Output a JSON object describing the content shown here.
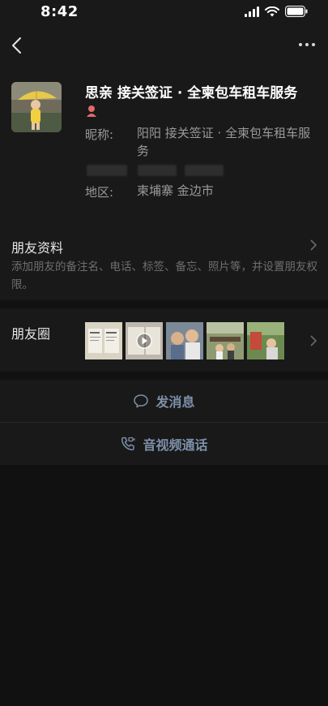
{
  "status_bar": {
    "time": "8:42"
  },
  "profile": {
    "name": "思亲 接关签证 · 全柬包车租车服务",
    "nickname_label": "昵称:",
    "nickname_value": "阳阳 接关签证 · 全柬包车租车服务",
    "region_label": "地区:",
    "region_value": "柬埔寨 金边市"
  },
  "friend_info": {
    "title": "朋友资料",
    "description": "添加朋友的备注名、电话、标签、备忘、照片等，并设置朋友权限。"
  },
  "moments": {
    "title": "朋友圈"
  },
  "actions": {
    "send_message": "发消息",
    "av_call": "音视频通话"
  },
  "colors": {
    "accent_link": "#7d90a9",
    "background": "#111111",
    "panel": "#191919",
    "gender_female": "#e06a6a"
  },
  "icons": [
    "back-arrow-icon",
    "more-dots-icon",
    "female-gender-icon",
    "chevron-right-icon",
    "chat-bubble-icon",
    "video-call-icon",
    "play-icon"
  ]
}
